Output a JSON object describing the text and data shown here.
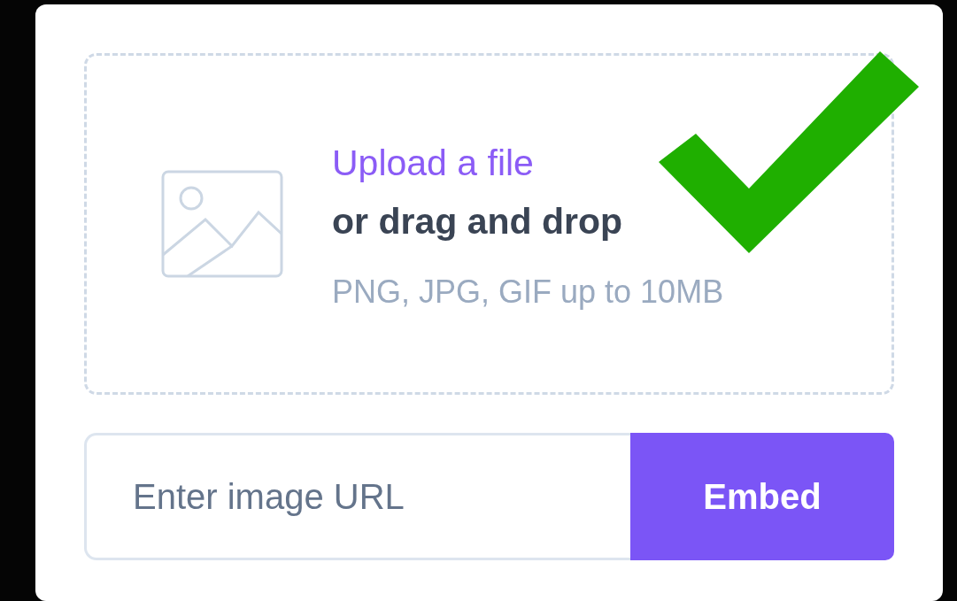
{
  "dropzone": {
    "link": "Upload a file",
    "text": "or drag and drop",
    "hint": "PNG, JPG, GIF up to 10MB"
  },
  "url_field": {
    "placeholder": "Enter image URL"
  },
  "embed_button": {
    "label": "Embed"
  }
}
